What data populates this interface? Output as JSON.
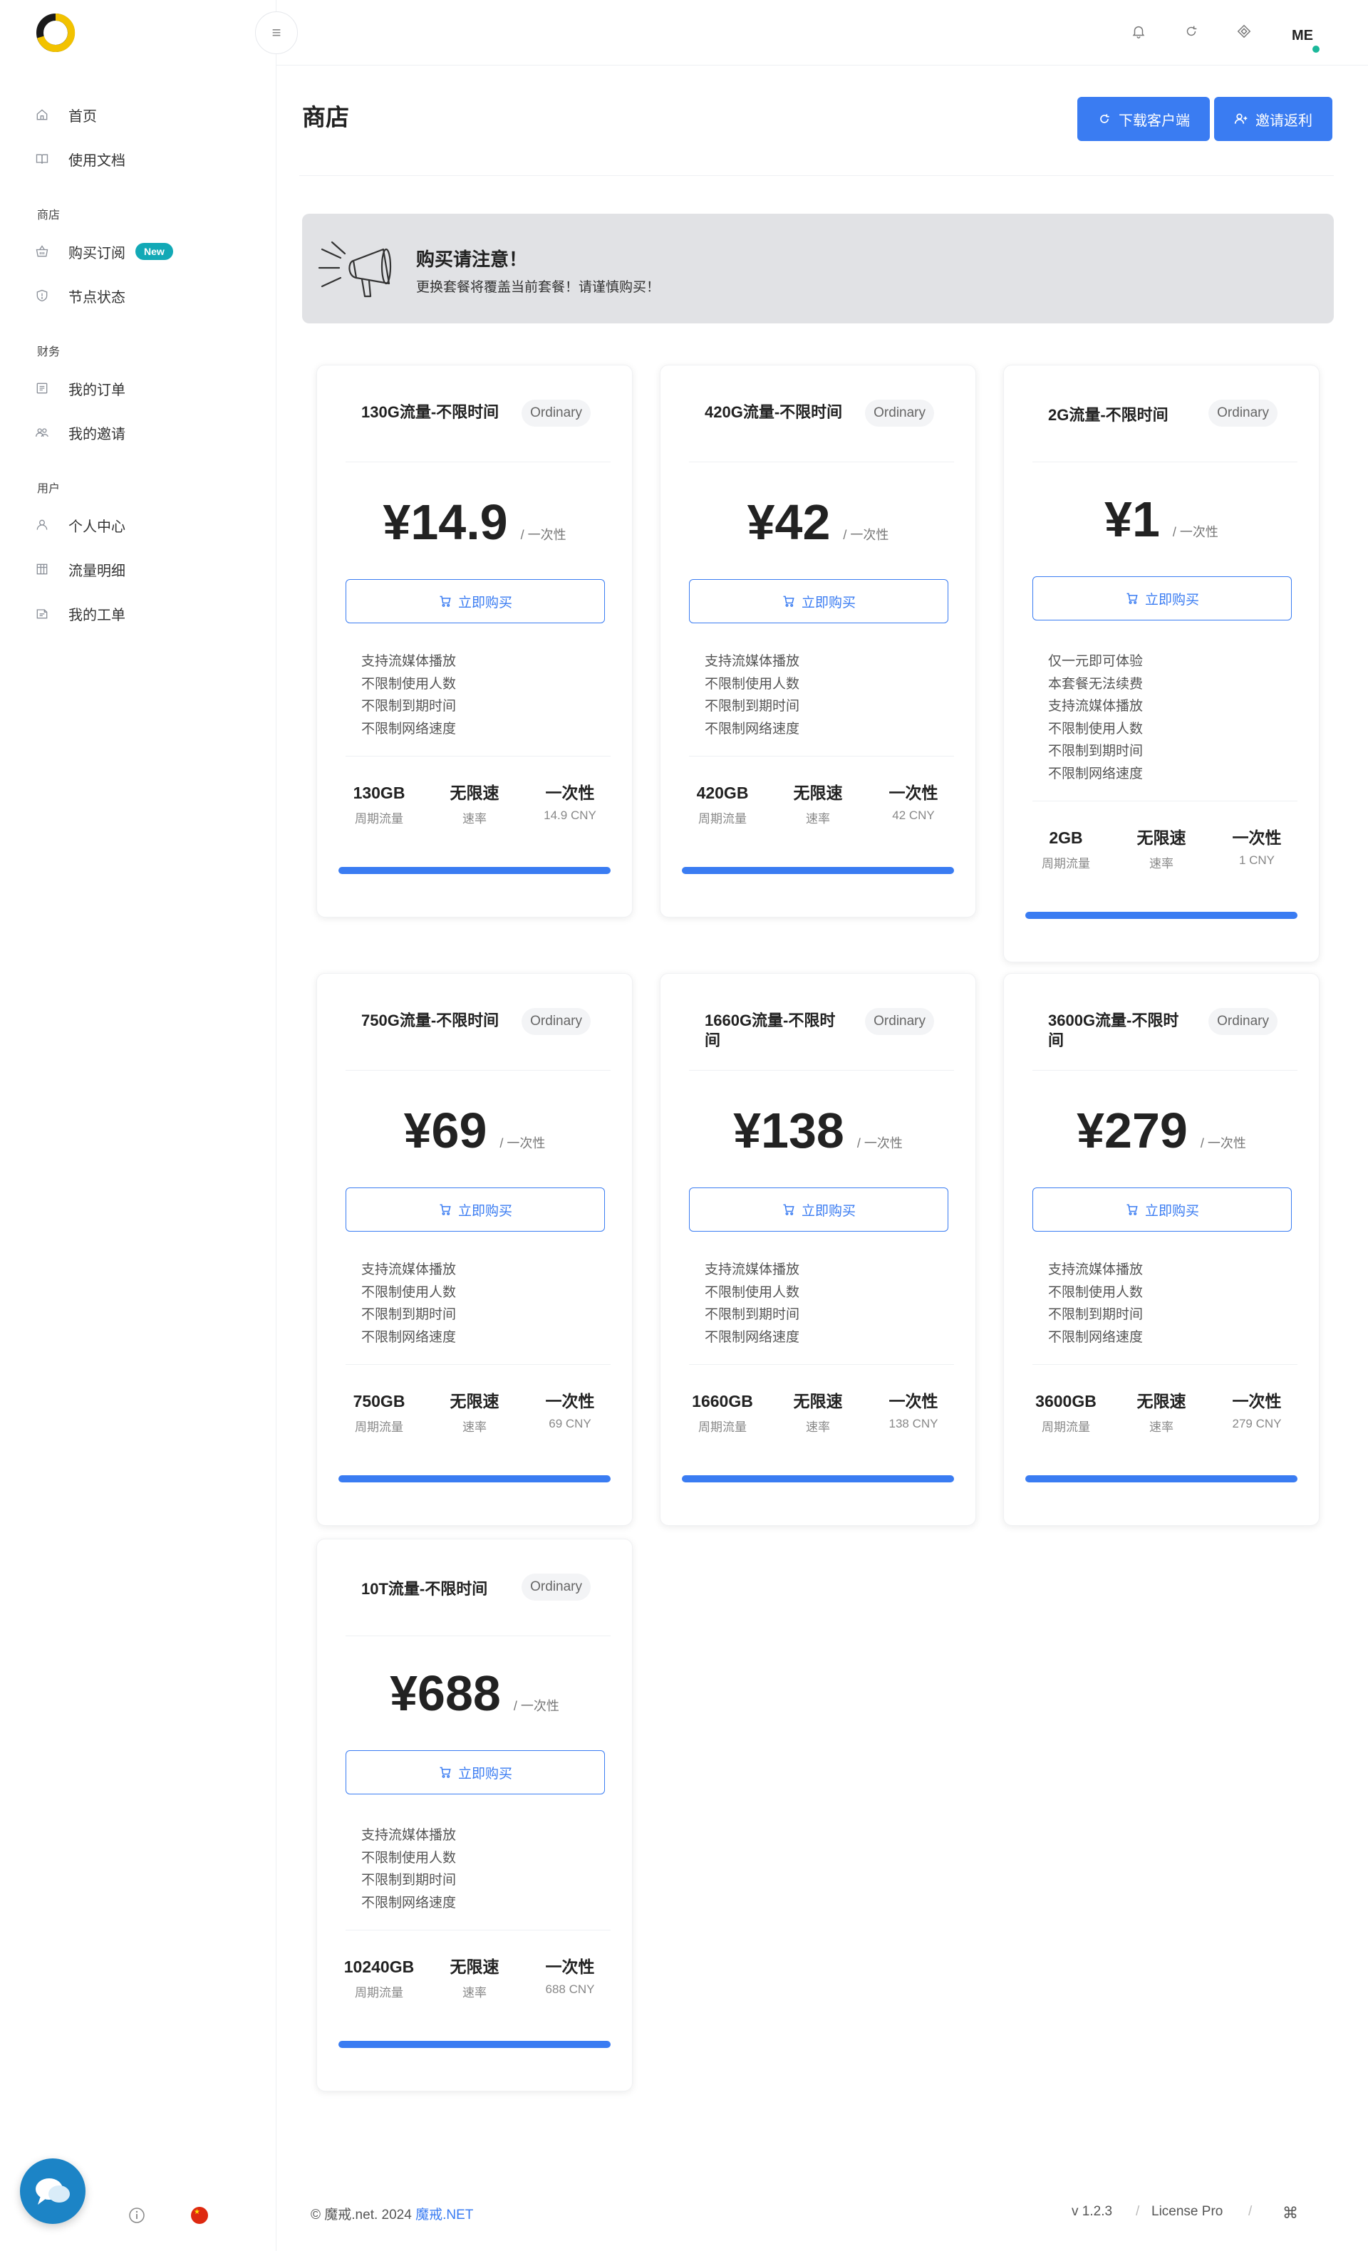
{
  "sidebar": {
    "items_top": [
      {
        "label": "首页",
        "icon": "home-icon"
      },
      {
        "label": "使用文档",
        "icon": "book-icon"
      }
    ],
    "sections": [
      {
        "title": "商店",
        "items": [
          {
            "label": "购买订阅",
            "icon": "basket-icon",
            "badge": "New"
          },
          {
            "label": "节点状态",
            "icon": "shield-icon"
          }
        ]
      },
      {
        "title": "财务",
        "items": [
          {
            "label": "我的订单",
            "icon": "list-icon"
          },
          {
            "label": "我的邀请",
            "icon": "users-icon"
          }
        ]
      },
      {
        "title": "用户",
        "items": [
          {
            "label": "个人中心",
            "icon": "user-icon"
          },
          {
            "label": "流量明细",
            "icon": "table-icon"
          },
          {
            "label": "我的工单",
            "icon": "ticket-icon"
          }
        ]
      }
    ]
  },
  "topbar": {
    "avatar": "ME"
  },
  "header": {
    "title": "商店",
    "download_label": "下载客户端",
    "invite_label": "邀请返利"
  },
  "notice": {
    "title": "购买请注意！",
    "text": "更换套餐将覆盖当前套餐！请谨慎购买！"
  },
  "buy_label": "立即购买",
  "plans": [
    {
      "name": "130G流量-不限时间",
      "tag": "Ordinary",
      "price": "¥14.9",
      "period": "/ 一次性",
      "features": [
        "支持流媒体播放",
        "不限制使用人数",
        "不限制到期时间",
        "不限制网络速度"
      ],
      "stats": [
        {
          "v": "130GB",
          "l": "周期流量"
        },
        {
          "v": "无限速",
          "l": "速率"
        },
        {
          "v": "一次性",
          "l": "14.9 CNY"
        }
      ]
    },
    {
      "name": "420G流量-不限时间",
      "tag": "Ordinary",
      "price": "¥42",
      "period": "/ 一次性",
      "features": [
        "支持流媒体播放",
        "不限制使用人数",
        "不限制到期时间",
        "不限制网络速度"
      ],
      "stats": [
        {
          "v": "420GB",
          "l": "周期流量"
        },
        {
          "v": "无限速",
          "l": "速率"
        },
        {
          "v": "一次性",
          "l": "42 CNY"
        }
      ]
    },
    {
      "name": "2G流量-不限时间",
      "tag": "Ordinary",
      "price": "¥1",
      "period": "/ 一次性",
      "features": [
        "仅一元即可体验",
        "本套餐无法续费",
        "支持流媒体播放",
        "不限制使用人数",
        "不限制到期时间",
        "不限制网络速度"
      ],
      "stats": [
        {
          "v": "2GB",
          "l": "周期流量"
        },
        {
          "v": "无限速",
          "l": "速率"
        },
        {
          "v": "一次性",
          "l": "1 CNY"
        }
      ]
    },
    {
      "name": "750G流量-不限时间",
      "tag": "Ordinary",
      "price": "¥69",
      "period": "/ 一次性",
      "features": [
        "支持流媒体播放",
        "不限制使用人数",
        "不限制到期时间",
        "不限制网络速度"
      ],
      "stats": [
        {
          "v": "750GB",
          "l": "周期流量"
        },
        {
          "v": "无限速",
          "l": "速率"
        },
        {
          "v": "一次性",
          "l": "69 CNY"
        }
      ]
    },
    {
      "name": "1660G流量-不限时间",
      "tag": "Ordinary",
      "price": "¥138",
      "period": "/ 一次性",
      "features": [
        "支持流媒体播放",
        "不限制使用人数",
        "不限制到期时间",
        "不限制网络速度"
      ],
      "stats": [
        {
          "v": "1660GB",
          "l": "周期流量"
        },
        {
          "v": "无限速",
          "l": "速率"
        },
        {
          "v": "一次性",
          "l": "138 CNY"
        }
      ]
    },
    {
      "name": "3600G流量-不限时间",
      "tag": "Ordinary",
      "price": "¥279",
      "period": "/ 一次性",
      "features": [
        "支持流媒体播放",
        "不限制使用人数",
        "不限制到期时间",
        "不限制网络速度"
      ],
      "stats": [
        {
          "v": "3600GB",
          "l": "周期流量"
        },
        {
          "v": "无限速",
          "l": "速率"
        },
        {
          "v": "一次性",
          "l": "279 CNY"
        }
      ]
    },
    {
      "name": "10T流量-不限时间",
      "tag": "Ordinary",
      "price": "¥688",
      "period": "/ 一次性",
      "features": [
        "支持流媒体播放",
        "不限制使用人数",
        "不限制到期时间",
        "不限制网络速度"
      ],
      "stats": [
        {
          "v": "10240GB",
          "l": "周期流量"
        },
        {
          "v": "无限速",
          "l": "速率"
        },
        {
          "v": "一次性",
          "l": "688 CNY"
        }
      ]
    }
  ],
  "footer": {
    "copyright": "© 魔戒.net. 2024 ",
    "link": "魔戒.NET",
    "version": "v 1.2.3",
    "separator": "/",
    "license": "License Pro"
  },
  "colors": {
    "accent": "#3a7cf2",
    "badge": "#12a9b6",
    "notice_bg": "#e1e2e5",
    "online": "#1bb89a"
  }
}
